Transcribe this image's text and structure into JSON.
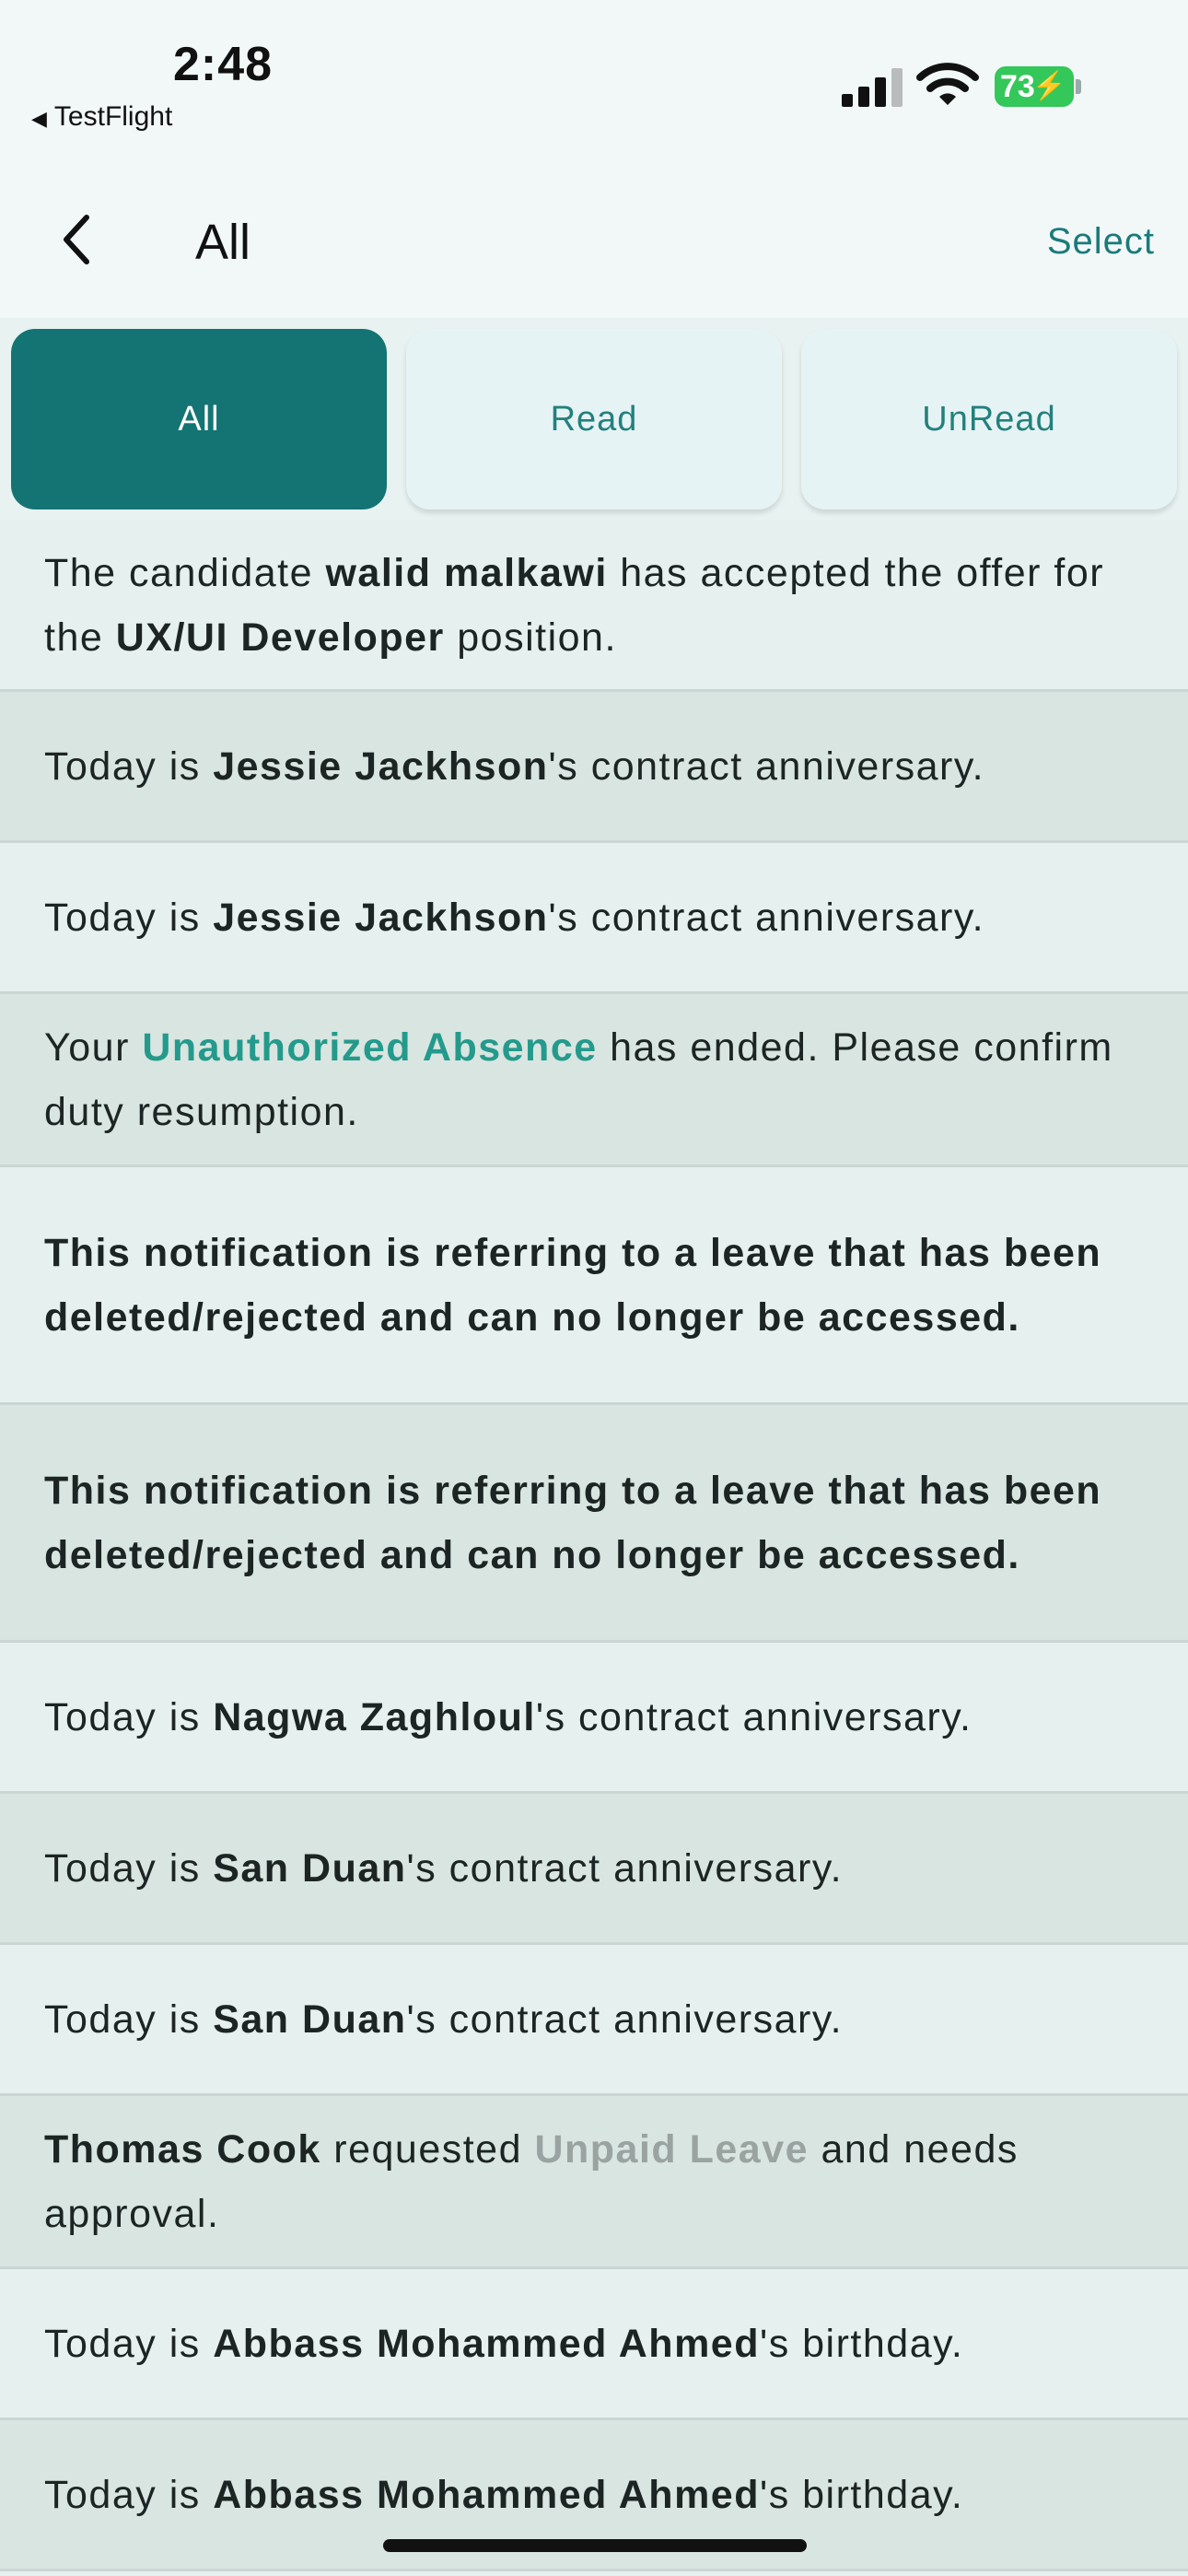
{
  "status": {
    "time": "2:48",
    "back_app": "TestFlight",
    "battery": "73"
  },
  "nav": {
    "title": "All",
    "select_label": "Select"
  },
  "tabs": [
    {
      "label": "All",
      "active": true
    },
    {
      "label": "Read",
      "active": false
    },
    {
      "label": "UnRead",
      "active": false
    }
  ],
  "notifications": [
    {
      "parts": [
        {
          "t": "The candidate "
        },
        {
          "t": "walid malkawi",
          "s": "b"
        },
        {
          "t": " has accepted the offer for the "
        },
        {
          "t": "UX/UI Developer",
          "s": "b"
        },
        {
          "t": " position."
        }
      ]
    },
    {
      "parts": [
        {
          "t": "Today is "
        },
        {
          "t": "Jessie Jackhson",
          "s": "b"
        },
        {
          "t": "'s contract anniversary."
        }
      ]
    },
    {
      "parts": [
        {
          "t": "Today is "
        },
        {
          "t": "Jessie Jackhson",
          "s": "b"
        },
        {
          "t": "'s contract anniversary."
        }
      ]
    },
    {
      "parts": [
        {
          "t": "Your "
        },
        {
          "t": "Unauthorized Absence",
          "s": "teal"
        },
        {
          "t": " has ended. Please confirm duty resumption."
        }
      ]
    },
    {
      "parts": [
        {
          "t": "This notification is referring to a leave that has been deleted/rejected and can no longer be accessed.",
          "s": "b"
        }
      ]
    },
    {
      "parts": [
        {
          "t": "This notification is referring to a leave that has been deleted/rejected and can no longer be accessed.",
          "s": "b"
        }
      ]
    },
    {
      "parts": [
        {
          "t": "Today is "
        },
        {
          "t": "Nagwa Zaghloul",
          "s": "b"
        },
        {
          "t": "'s contract anniversary."
        }
      ]
    },
    {
      "parts": [
        {
          "t": "Today is "
        },
        {
          "t": "San Duan",
          "s": "b"
        },
        {
          "t": "'s contract anniversary."
        }
      ]
    },
    {
      "parts": [
        {
          "t": "Today is "
        },
        {
          "t": "San Duan",
          "s": "b"
        },
        {
          "t": "'s contract anniversary."
        }
      ]
    },
    {
      "parts": [
        {
          "t": "Thomas Cook",
          "s": "b"
        },
        {
          "t": " requested "
        },
        {
          "t": "Unpaid Leave",
          "s": "grey"
        },
        {
          "t": " and needs approval."
        }
      ]
    },
    {
      "parts": [
        {
          "t": "Today is "
        },
        {
          "t": "Abbass Mohammed Ahmed",
          "s": "b"
        },
        {
          "t": "'s birthday."
        }
      ]
    },
    {
      "parts": [
        {
          "t": "Today is "
        },
        {
          "t": "Abbass Mohammed Ahmed",
          "s": "b"
        },
        {
          "t": "'s birthday."
        }
      ]
    }
  ]
}
